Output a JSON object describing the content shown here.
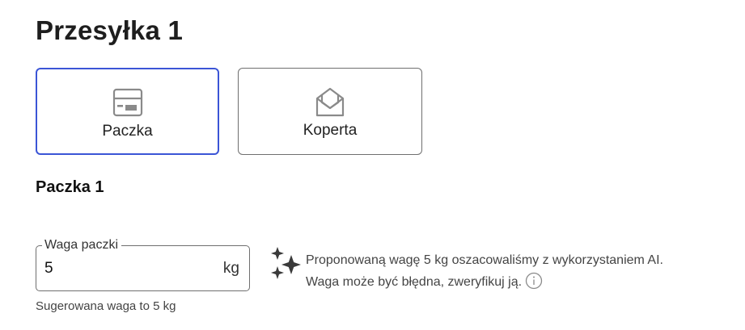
{
  "page": {
    "title": "Przesyłka 1"
  },
  "shipment_types": [
    {
      "label": "Paczka",
      "icon": "package-icon",
      "selected": true
    },
    {
      "label": "Koperta",
      "icon": "envelope-icon",
      "selected": false
    }
  ],
  "parcel": {
    "section_title": "Paczka 1",
    "weight_field": {
      "label": "Waga paczki",
      "value": "5",
      "unit": "kg"
    },
    "helper_text": "Sugerowana waga to 5 kg"
  },
  "ai_suggestion": {
    "icon": "sparkle-icon",
    "line1": "Proponowaną wagę 5 kg oszacowaliśmy z wykorzystaniem AI.",
    "line2": "Waga może być błędna, zweryfikuj ją.",
    "info_icon": "info-icon"
  },
  "colors": {
    "selected_border": "#3b55d6",
    "border": "#6f6f6f",
    "text": "#1e1e1e",
    "muted_text": "#444444"
  }
}
